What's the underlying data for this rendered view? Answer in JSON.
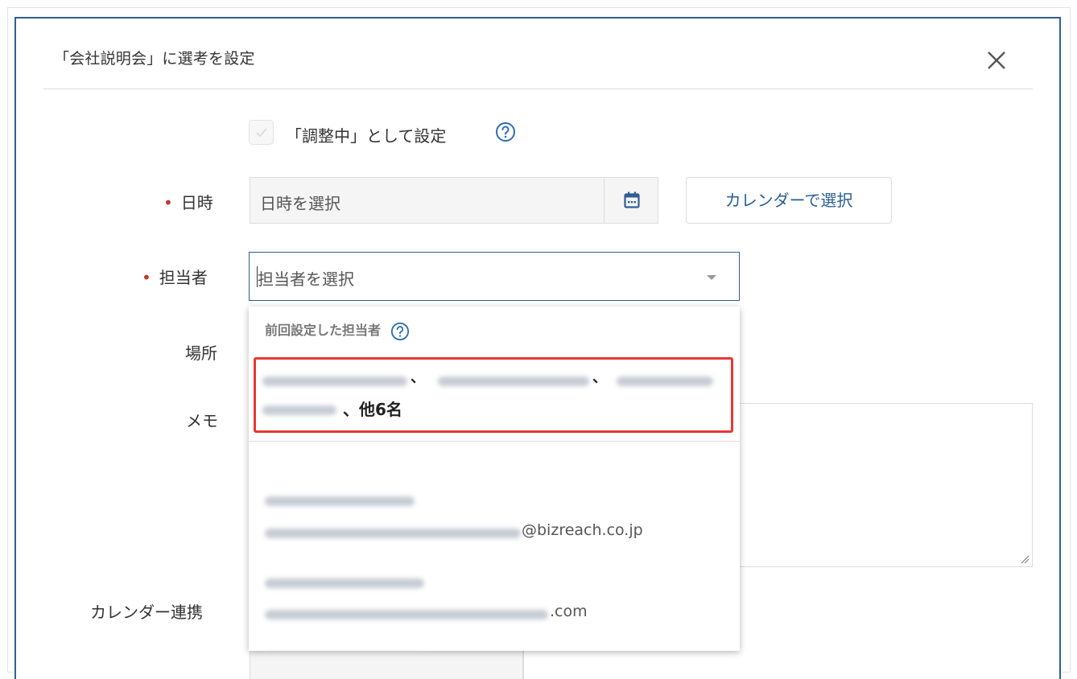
{
  "modal": {
    "title": "「会社説明会」に選考を設定",
    "close_icon": "close-icon"
  },
  "adjusting": {
    "label": "「調整中」として設定",
    "checked": false,
    "help_icon": "question-circle-icon"
  },
  "form": {
    "datetime": {
      "label": "日時",
      "required": true,
      "placeholder": "日時を選択",
      "calendar_icon": "calendar-icon",
      "calendar_button": "カレンダーで選択"
    },
    "assignee": {
      "label": "担当者",
      "required": true,
      "placeholder": "担当者を選択",
      "caret_icon": "caret-down-icon"
    },
    "location": {
      "label": "場所"
    },
    "memo": {
      "label": "メモ"
    },
    "calendar_link": {
      "label": "カレンダー連携"
    }
  },
  "dropdown": {
    "section_title": "前回設定した担当者",
    "previous_item": {
      "separator": "、",
      "more": "、他6名"
    },
    "users": [
      {
        "email_suffix": "@bizreach.co.jp"
      },
      {
        "email_suffix": ".com"
      }
    ]
  },
  "colors": {
    "accent": "#2f5f93",
    "required": "#c0392b",
    "highlight": "#e53935"
  }
}
